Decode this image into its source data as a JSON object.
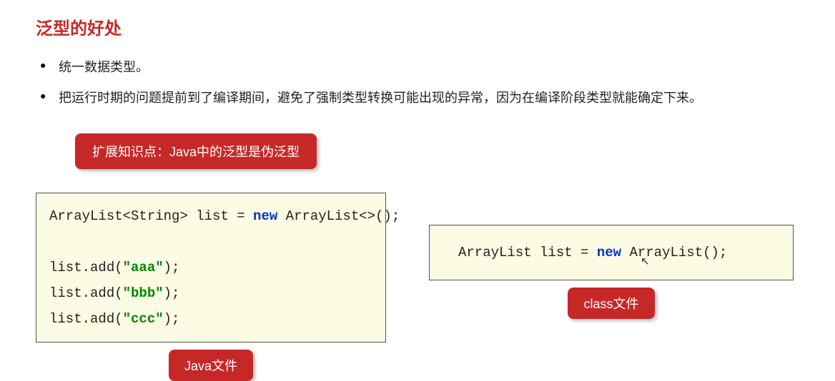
{
  "title": "泛型的好处",
  "bullets": [
    "统一数据类型。",
    "把运行时期的问题提前到了编译期间，避免了强制类型转换可能出现的异常，因为在编译阶段类型就能确定下来。"
  ],
  "knowledge_badge": "扩展知识点：Java中的泛型是伪泛型",
  "code_left": {
    "line1_a": "ArrayList<String> list = ",
    "line1_kw": "new",
    "line1_b": " ArrayList<>();",
    "line2_a": "list.add(",
    "line2_s": "\"aaa\"",
    "line2_b": ");",
    "line3_a": "list.add(",
    "line3_s": "\"bbb\"",
    "line3_b": ");",
    "line4_a": "list.add(",
    "line4_s": "\"ccc\"",
    "line4_b": ");"
  },
  "code_right": {
    "line1_a": "ArrayList list = ",
    "line1_kw": "new",
    "line1_b": " ArrayList();"
  },
  "label_left": "Java文件",
  "label_right": "class文件"
}
